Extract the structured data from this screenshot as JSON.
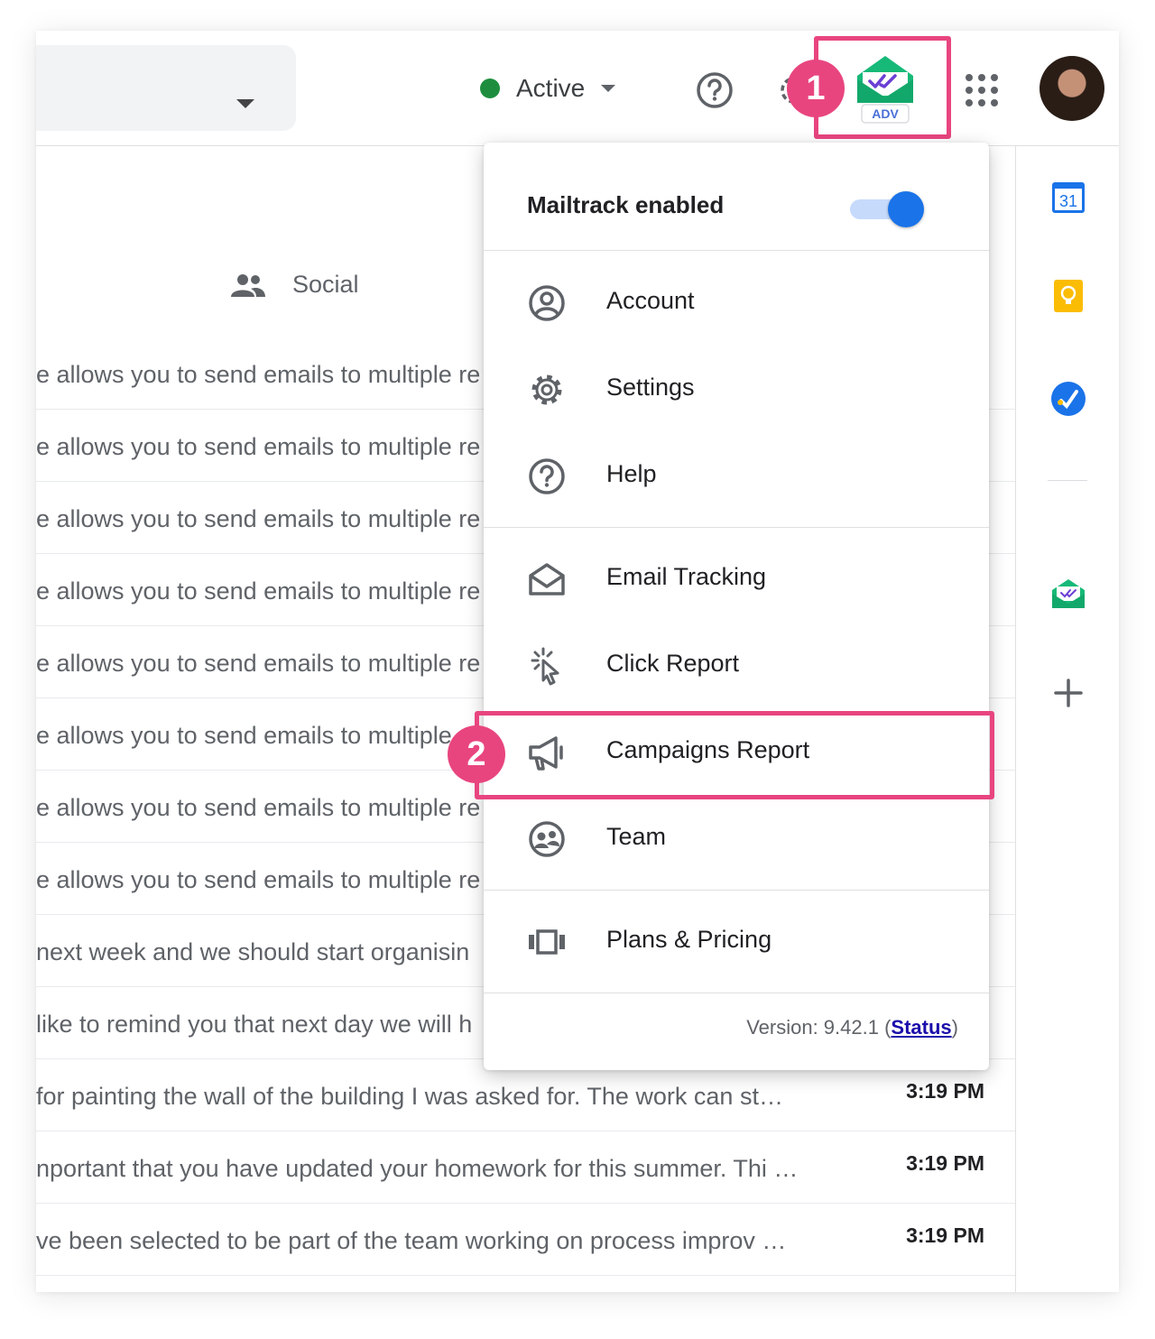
{
  "header": {
    "status_label": "Active",
    "status_color": "#1e8e3e",
    "mailtrack_badge_text": "ADV"
  },
  "callouts": {
    "badge_1": "1",
    "badge_2": "2",
    "highlight_color": "#e8457f"
  },
  "tabs": {
    "social_label": "Social"
  },
  "mail_rows": [
    {
      "snippet": "e allows you to send emails to multiple re",
      "time": ""
    },
    {
      "snippet": "e allows you to send emails to multiple re",
      "time": ""
    },
    {
      "snippet": "e allows you to send emails to multiple re",
      "time": ""
    },
    {
      "snippet": "e allows you to send emails to multiple re",
      "time": ""
    },
    {
      "snippet": "e allows you to send emails to multiple re",
      "time": ""
    },
    {
      "snippet": "e allows you to send emails to multiple",
      "time": ""
    },
    {
      "snippet": "e allows you to send emails to multiple re",
      "time": ""
    },
    {
      "snippet": "e allows you to send emails to multiple re",
      "time": ""
    },
    {
      "snippet": "next week and we should start organisin",
      "time": ""
    },
    {
      "snippet": "like to remind you that next day we will h",
      "time": ""
    },
    {
      "snippet": "for painting the wall of the building I was asked for. The work can st…",
      "time": "3:19 PM"
    },
    {
      "snippet": "nportant that you have updated your homework for this summer. Thi …",
      "time": "3:19 PM"
    },
    {
      "snippet": "ve been selected to be part of the team working on process improv   …",
      "time": "3:19 PM"
    }
  ],
  "side_panel": {
    "calendar_day": "31"
  },
  "menu": {
    "title": "Mailtrack enabled",
    "toggle_on": true,
    "items": [
      {
        "label": "Account",
        "icon": "account-circle-icon"
      },
      {
        "label": "Settings",
        "icon": "gear-icon"
      },
      {
        "label": "Help",
        "icon": "help-circle-icon"
      },
      {
        "label": "Email Tracking",
        "icon": "open-envelope-icon"
      },
      {
        "label": "Click Report",
        "icon": "click-cursor-icon"
      },
      {
        "label": "Campaigns Report",
        "icon": "megaphone-icon"
      },
      {
        "label": "Team",
        "icon": "team-icon"
      },
      {
        "label": "Plans & Pricing",
        "icon": "plans-icon"
      }
    ],
    "version_text": "Version: 9.42.1 (",
    "status_link": "Status",
    "version_close": ")"
  }
}
